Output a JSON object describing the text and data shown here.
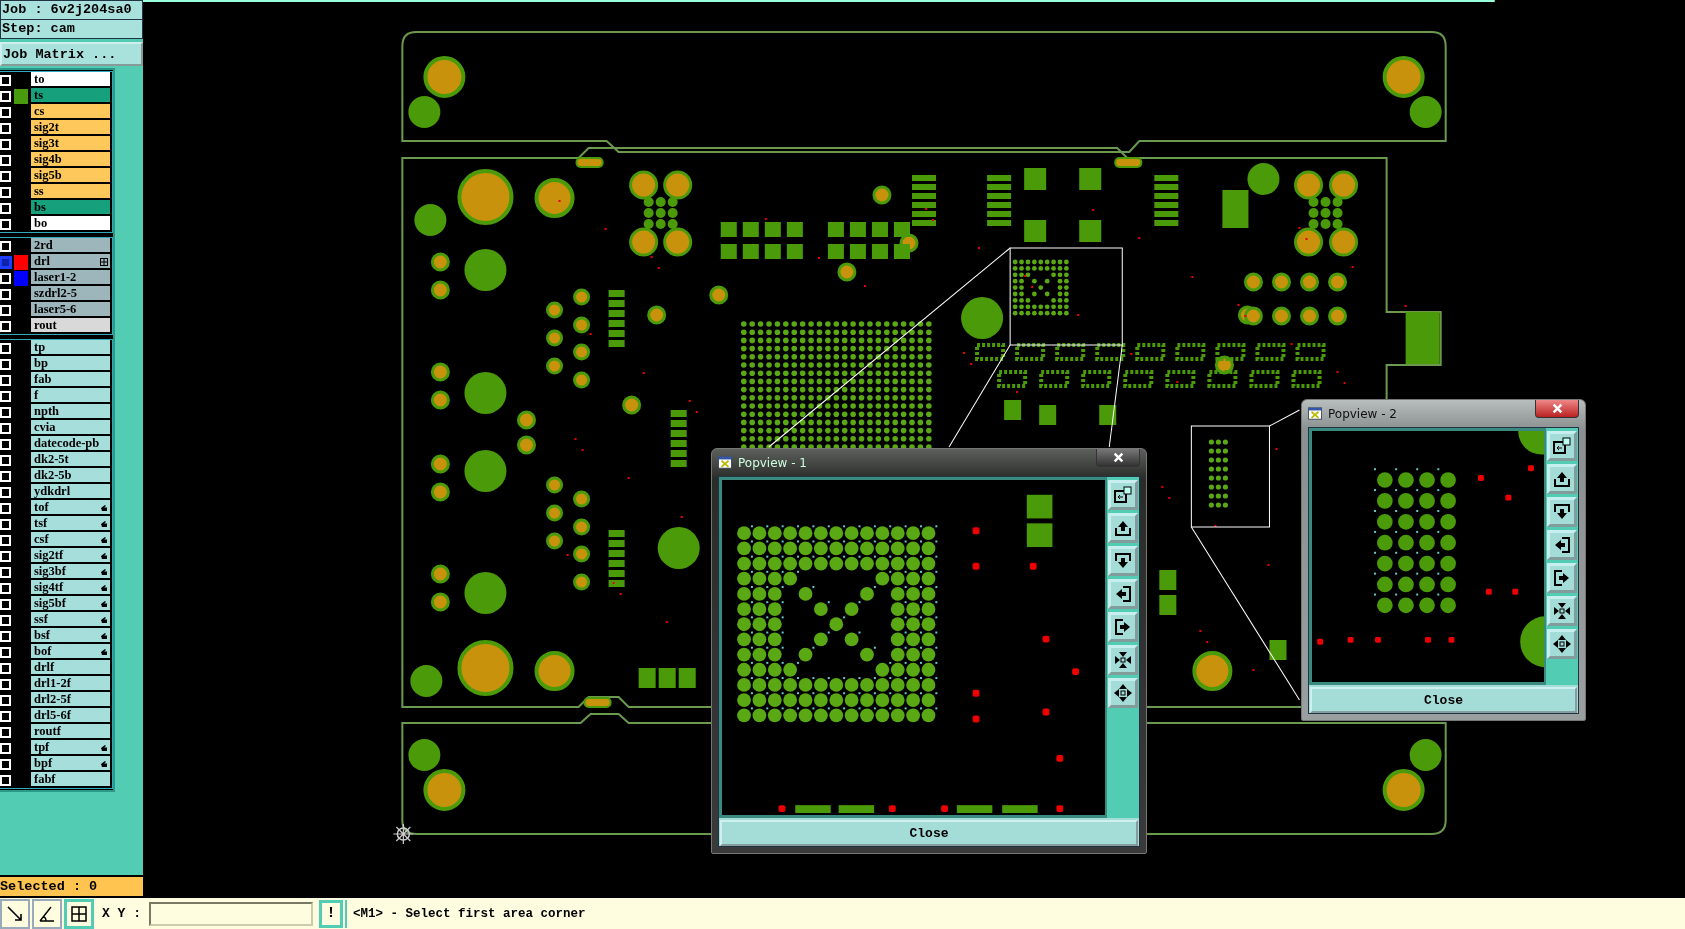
{
  "job_panel": {
    "job": "Job : 6v2j204sa0",
    "step": "Step: cam",
    "matrix_button": "Job Matrix ..."
  },
  "layer_groups": [
    {
      "layers": [
        {
          "name": "to",
          "kind": "silk",
          "highlighted": false
        },
        {
          "name": "ts",
          "kind": "mask",
          "color": "#4a9a10",
          "highlighted": false
        },
        {
          "name": "cs",
          "kind": "signal",
          "highlighted": false
        },
        {
          "name": "sig2t",
          "kind": "signal",
          "highlighted": false
        },
        {
          "name": "sig3t",
          "kind": "signal",
          "highlighted": false
        },
        {
          "name": "sig4b",
          "kind": "signal",
          "highlighted": false
        },
        {
          "name": "sig5b",
          "kind": "signal",
          "highlighted": false
        },
        {
          "name": "ss",
          "kind": "signal",
          "highlighted": false
        },
        {
          "name": "bs",
          "kind": "mask",
          "highlighted": false
        },
        {
          "name": "bo",
          "kind": "silk",
          "highlighted": false
        }
      ]
    },
    {
      "layers": [
        {
          "name": "2rd",
          "kind": "drill",
          "highlighted": false
        },
        {
          "name": "drl",
          "kind": "drill",
          "color": "#ff0000",
          "grid_mark": true,
          "highlighted": true
        },
        {
          "name": "laser1-2",
          "kind": "drill",
          "color": "#0000ff",
          "highlighted": false
        },
        {
          "name": "szdrl2-5",
          "kind": "drill",
          "highlighted": false
        },
        {
          "name": "laser5-6",
          "kind": "drill",
          "highlighted": false
        },
        {
          "name": "rout",
          "kind": "rout",
          "highlighted": false
        }
      ]
    },
    {
      "layers": [
        {
          "name": "tp",
          "kind": "document",
          "highlighted": false
        },
        {
          "name": "bp",
          "kind": "document",
          "highlighted": false
        },
        {
          "name": "fab",
          "kind": "document",
          "highlighted": false
        },
        {
          "name": "f",
          "kind": "document",
          "highlighted": false
        },
        {
          "name": "npth",
          "kind": "document",
          "highlighted": false
        },
        {
          "name": "cvia",
          "kind": "document",
          "highlighted": false
        },
        {
          "name": "datecode-pb",
          "kind": "document",
          "highlighted": false
        },
        {
          "name": "dk2-5t",
          "kind": "document",
          "highlighted": false
        },
        {
          "name": "dk2-5b",
          "kind": "document",
          "highlighted": false
        },
        {
          "name": "ydkdrl",
          "kind": "document",
          "highlighted": false
        },
        {
          "name": "tof",
          "kind": "document",
          "hand_mark": true,
          "highlighted": false
        },
        {
          "name": "tsf",
          "kind": "document",
          "hand_mark": true,
          "highlighted": false
        },
        {
          "name": "csf",
          "kind": "document",
          "hand_mark": true,
          "highlighted": false
        },
        {
          "name": "sig2tf",
          "kind": "document",
          "hand_mark": true,
          "highlighted": false
        },
        {
          "name": "sig3bf",
          "kind": "document",
          "hand_mark": true,
          "highlighted": false
        },
        {
          "name": "sig4tf",
          "kind": "document",
          "hand_mark": true,
          "highlighted": false
        },
        {
          "name": "sig5bf",
          "kind": "document",
          "hand_mark": true,
          "highlighted": false
        },
        {
          "name": "ssf",
          "kind": "document",
          "hand_mark": true,
          "highlighted": false
        },
        {
          "name": "bsf",
          "kind": "document",
          "hand_mark": true,
          "highlighted": false
        },
        {
          "name": "bof",
          "kind": "document",
          "hand_mark": true,
          "highlighted": false
        },
        {
          "name": "drlf",
          "kind": "document",
          "highlighted": false
        },
        {
          "name": "drl1-2f",
          "kind": "document",
          "highlighted": false
        },
        {
          "name": "drl2-5f",
          "kind": "document",
          "highlighted": false
        },
        {
          "name": "drl5-6f",
          "kind": "document",
          "highlighted": false
        },
        {
          "name": "routf",
          "kind": "document",
          "highlighted": false
        },
        {
          "name": "tpf",
          "kind": "document",
          "hand_mark": true,
          "highlighted": false
        },
        {
          "name": "bpf",
          "kind": "document",
          "hand_mark": true,
          "highlighted": false
        },
        {
          "name": "fabf",
          "kind": "document",
          "highlighted": false
        }
      ]
    }
  ],
  "selected_count": "Selected : 0",
  "toolbar": {
    "tools": [
      {
        "kind": "diagonal-arrow",
        "selected": false
      },
      {
        "kind": "angle",
        "selected": false
      },
      {
        "kind": "grid",
        "selected": true
      }
    ],
    "coordinate_label": "X Y :",
    "alert_button": "!",
    "message": "<M1> - Select first area corner"
  },
  "popviews": [
    {
      "title": "Popview - 1",
      "kind": "bga",
      "active": false,
      "close_button": "Close"
    },
    {
      "title": "Popview - 2",
      "kind": "pad-array",
      "active": true,
      "close_button": "Close"
    }
  ]
}
